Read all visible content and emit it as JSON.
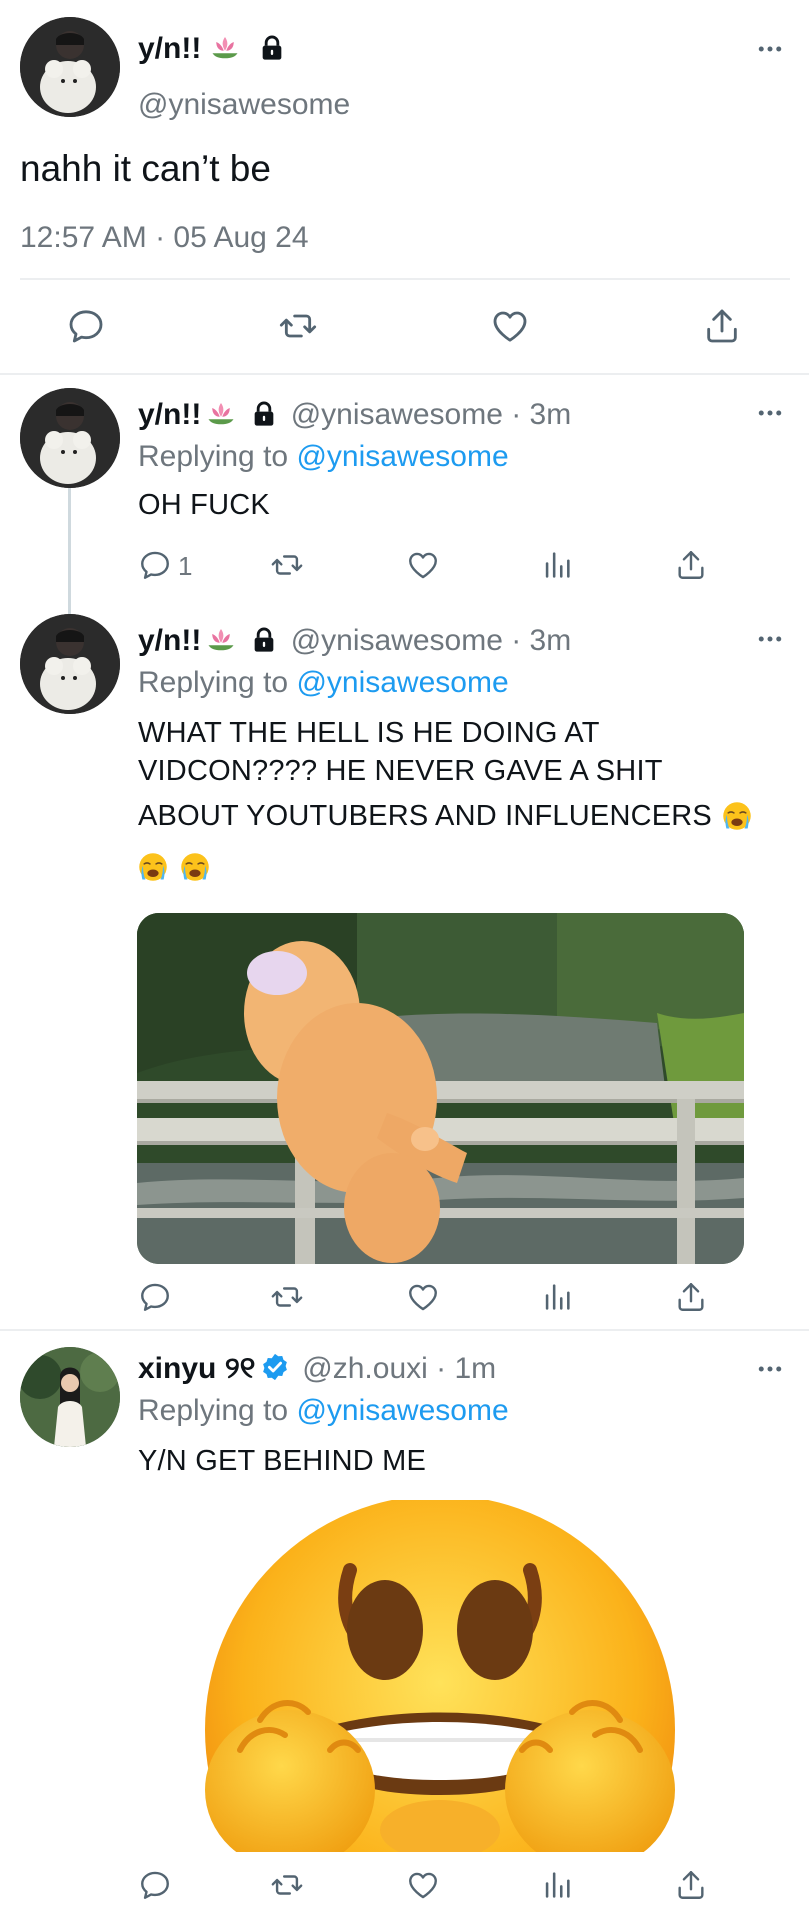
{
  "main_tweet": {
    "display_name": "y/n!!",
    "handle": "@ynisawesome",
    "text": "nahh it can’t be",
    "timestamp": "12:57 AM · 05 Aug 24"
  },
  "replies": [
    {
      "display_name": "y/n!!",
      "handle_time": "@ynisawesome · 3m",
      "replying_prefix": "Replying to ",
      "replying_to": "@ynisawesome",
      "lines": [
        "OH FUCK"
      ],
      "reply_count": "1"
    },
    {
      "display_name": "y/n!!",
      "handle_time": "@ynisawesome · 3m",
      "replying_prefix": "Replying to ",
      "replying_to": "@ynisawesome",
      "lines": [
        "WHAT THE HELL IS HE DOING AT",
        "VIDCON???? HE NEVER GAVE A SHIT",
        "ABOUT YOUTUBERS AND INFLUENCERS"
      ]
    },
    {
      "display_name": "xinyu",
      "name_suffix": "୨୧",
      "handle_time": "@zh.ouxi · 1m",
      "replying_prefix": "Replying to ",
      "replying_to": "@ynisawesome",
      "lines": [
        "Y/N GET BEHIND ME"
      ]
    }
  ],
  "more_label": "•••",
  "colors": {
    "accent": "#1d9bf0",
    "muted": "#6e767d",
    "text": "#0f1419",
    "divider": "#eceef0"
  },
  "icons": [
    "lotus-icon",
    "lock-icon",
    "verified-icon",
    "reply-icon",
    "retweet-icon",
    "like-icon",
    "views-icon",
    "share-icon",
    "loudly-crying-emoji",
    "grimacing-emoji"
  ]
}
